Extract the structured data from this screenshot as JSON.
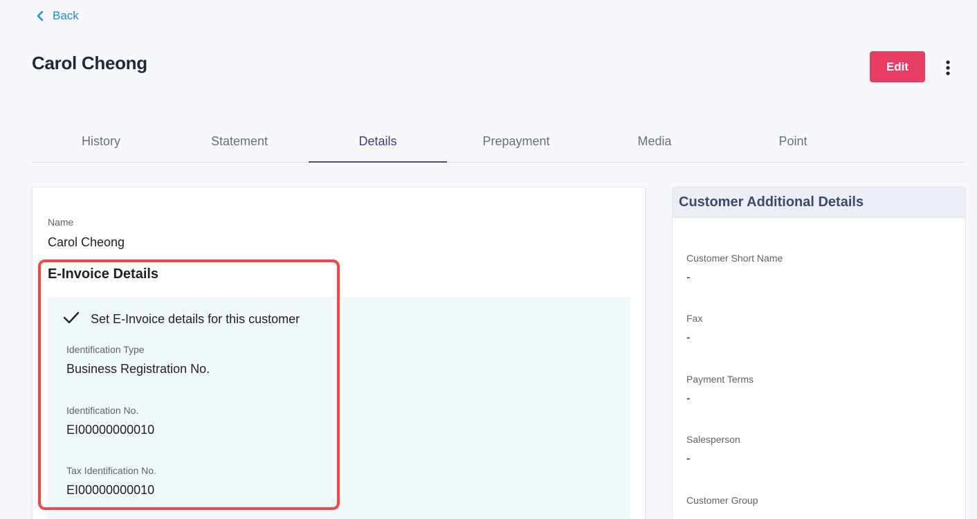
{
  "nav": {
    "back_label": "Back"
  },
  "header": {
    "title": "Carol Cheong",
    "edit_label": "Edit"
  },
  "tabs": [
    {
      "label": "History"
    },
    {
      "label": "Statement"
    },
    {
      "label": "Details"
    },
    {
      "label": "Prepayment"
    },
    {
      "label": "Media"
    },
    {
      "label": "Point"
    }
  ],
  "active_tab": "Details",
  "details": {
    "name_label": "Name",
    "name_value": "Carol Cheong",
    "einvoice": {
      "heading": "E-Invoice Details",
      "checkbox_label": "Set E-Invoice details for this customer",
      "checked": true,
      "id_type_label": "Identification Type",
      "id_type_value": "Business Registration No.",
      "id_no_label": "Identification No.",
      "id_no_value": "EI00000000010",
      "tax_id_label": "Tax Identification No.",
      "tax_id_value": "EI00000000010"
    }
  },
  "additional": {
    "title": "Customer Additional Details",
    "fields": [
      {
        "label": "Customer Short Name",
        "value": "-"
      },
      {
        "label": "Fax",
        "value": "-"
      },
      {
        "label": "Payment Terms",
        "value": "-"
      },
      {
        "label": "Salesperson",
        "value": "-"
      },
      {
        "label": "Customer Group",
        "value": ""
      }
    ]
  },
  "colors": {
    "accent": "#e83e66",
    "link": "#1e8fd0",
    "tab_indicator": "#5b3fa0",
    "highlight": "#f04848",
    "einvoice_panel": "#f0f8fc"
  }
}
